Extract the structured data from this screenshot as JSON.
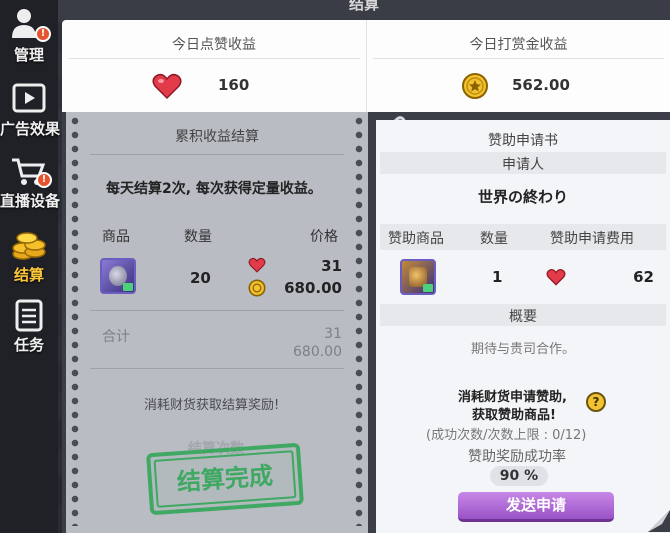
{
  "title": "结算",
  "sidebar": {
    "items": [
      {
        "label": "管理",
        "alert": "!"
      },
      {
        "label": "广告效果"
      },
      {
        "label": "直播设备",
        "alert": "!"
      },
      {
        "label": "结算"
      },
      {
        "label": "任务"
      }
    ]
  },
  "summary": {
    "likes_title": "今日点赞收益",
    "likes_value": "160",
    "reward_title": "今日打赏金收益",
    "reward_value": "562.00"
  },
  "left_panel": {
    "heading": "累积收益结算",
    "description": "每天结算2次, 每次获得定量收益。",
    "columns": [
      "商品",
      "数量",
      "价格"
    ],
    "row": {
      "quantity": "20",
      "price_likes": "31",
      "price_coins": "680.00"
    },
    "total_label": "合计",
    "total_likes": "31",
    "total_coins": "680.00",
    "notice": "消耗财货获取结算奖励!",
    "faded_label": "结算次数",
    "stamp": "结算完成"
  },
  "right_panel": {
    "heading": "赞助申请书",
    "applicant_label": "申请人",
    "applicant_name": "世界の終わり",
    "columns": [
      "赞助商品",
      "数量",
      "赞助申请费用"
    ],
    "row": {
      "quantity": "1",
      "cost": "62"
    },
    "summary_label": "概要",
    "summary_text": "期待与贵司合作。",
    "notice_line1": "消耗财货申请赞助,",
    "notice_line2": "获取赞助商品!",
    "help": "?",
    "attempts": "(成功次数/次数上限 : 0/12)",
    "rate_label": "赞助奖励成功率",
    "rate_value": "90 %",
    "send_button": "发送申请"
  },
  "colors": {
    "accent_purple": "#a65fd2",
    "stamp_green": "#3fa862",
    "active_nav": "#ffc73a",
    "heart": "#e23b4a",
    "coin": "#f2c230"
  }
}
